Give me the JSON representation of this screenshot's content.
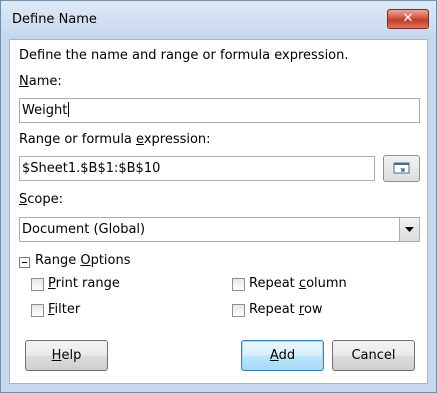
{
  "window": {
    "title": "Define Name",
    "close_glyph": "✕"
  },
  "form": {
    "description": "Define the name and range or formula expression.",
    "name_label_u": "N",
    "name_label_rest": "ame:",
    "name_value": "Weight",
    "range_label_a": "Range or formula ",
    "range_label_u": "e",
    "range_label_b": "xpression:",
    "range_value": "$Sheet1.$B$1:$B$10",
    "scope_label_u": "S",
    "scope_label_rest": "cope:",
    "scope_value": "Document (Global)"
  },
  "range_options": {
    "label_a": "Range ",
    "label_u": "O",
    "label_b": "ptions",
    "print_range": {
      "u": "P",
      "rest": "rint range",
      "checked": false
    },
    "filter": {
      "u": "F",
      "rest": "ilter",
      "checked": false
    },
    "repeat_column": {
      "a": "Repeat ",
      "u": "c",
      "b": "olumn",
      "checked": false
    },
    "repeat_row": {
      "a": "Repeat ",
      "u": "r",
      "b": "ow",
      "checked": false
    }
  },
  "buttons": {
    "help_u": "H",
    "help_rest": "elp",
    "add_u": "A",
    "add_rest": "dd",
    "cancel": "Cancel"
  },
  "icons": {
    "close": "close-icon",
    "shrink": "shrink-icon",
    "dropdown": "chevron-down-icon",
    "expander": "collapse-icon"
  }
}
